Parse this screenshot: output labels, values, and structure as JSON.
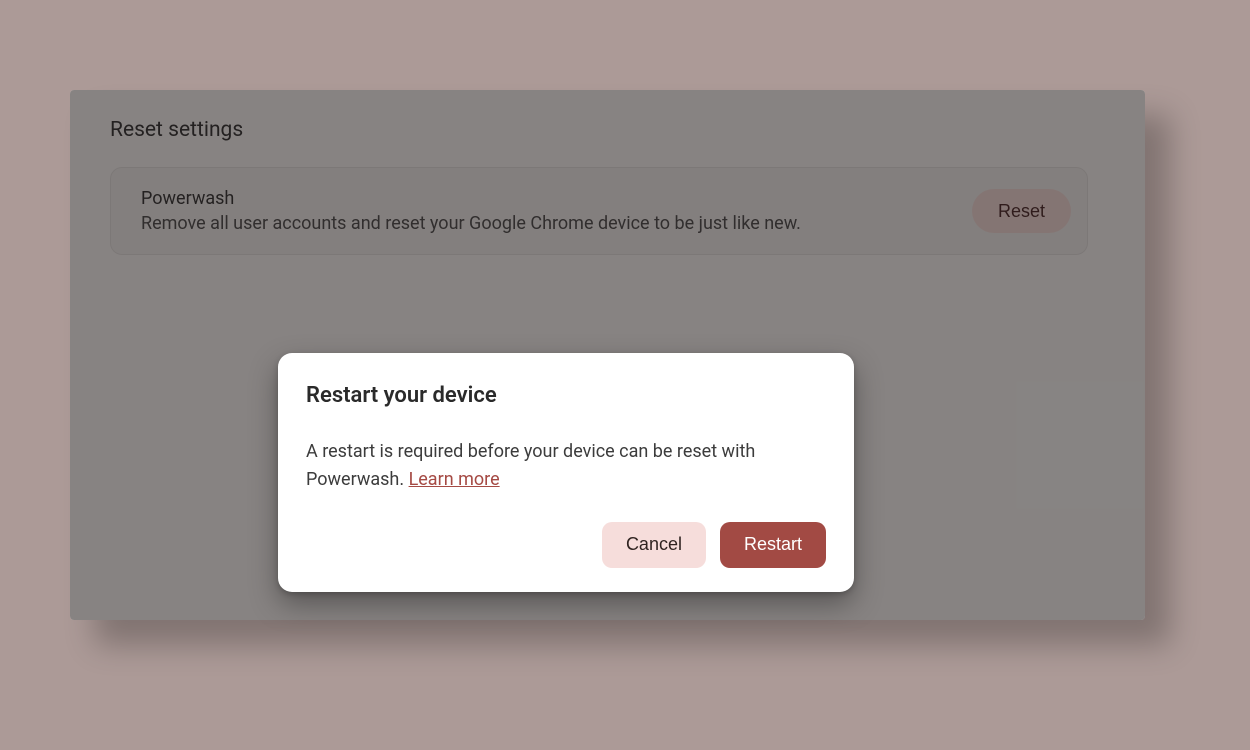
{
  "section": {
    "title": "Reset settings"
  },
  "powerwash_card": {
    "title": "Powerwash",
    "description": "Remove all user accounts and reset your Google Chrome device to be just like new.",
    "button_label": "Reset"
  },
  "dialog": {
    "title": "Restart your device",
    "body_text": "A restart is required before your device can be reset with Powerwash. ",
    "learn_more_label": "Learn more",
    "cancel_label": "Cancel",
    "restart_label": "Restart"
  }
}
